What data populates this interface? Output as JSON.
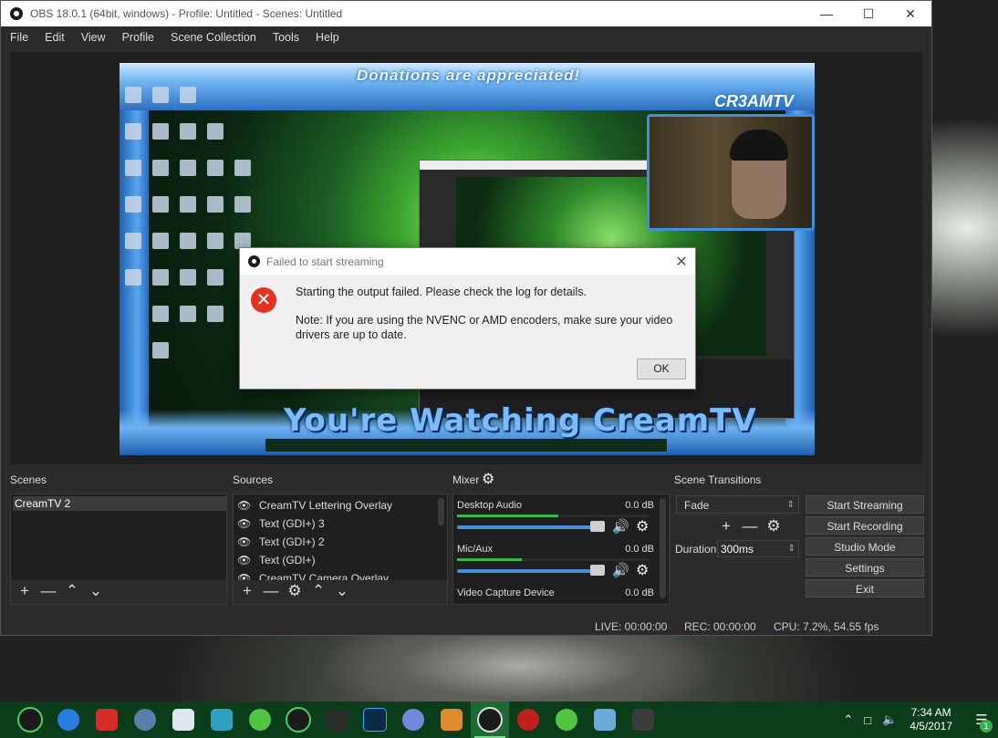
{
  "window": {
    "title": "OBS 18.0.1 (64bit, windows) - Profile: Untitled - Scenes: Untitled"
  },
  "menu": [
    "File",
    "Edit",
    "View",
    "Profile",
    "Scene Collection",
    "Tools",
    "Help"
  ],
  "preview": {
    "donations_text": "Donations are appreciated!",
    "watching_text": "You're Watching CreamTV",
    "logo_text": "CR3AMTV"
  },
  "dialog": {
    "title": "Failed to start streaming",
    "message": "Starting the output failed.  Please check the log for details.",
    "note": "Note: If you are using the NVENC or AMD encoders, make sure your video drivers are up to date.",
    "ok_label": "OK"
  },
  "docks": {
    "scenes_title": "Scenes",
    "sources_title": "Sources",
    "mixer_title": "Mixer",
    "transitions_title": "Scene Transitions"
  },
  "scenes": [
    "CreamTV 2"
  ],
  "sources": [
    "CreamTV Lettering Overlay",
    "Text (GDI+) 3",
    "Text (GDI+) 2",
    "Text (GDI+)",
    "CreamTV Camera Overlay"
  ],
  "mixer": [
    {
      "name": "Desktop Audio",
      "db": "0.0 dB",
      "level": 0.53
    },
    {
      "name": "Mic/Aux",
      "db": "0.0 dB",
      "level": 0.34
    },
    {
      "name": "Video Capture Device",
      "db": "0.0 dB",
      "level": 0
    }
  ],
  "transitions": {
    "selected": "Fade",
    "duration_label": "Duration",
    "duration_value": "300ms"
  },
  "controls": {
    "start_streaming": "Start Streaming",
    "start_recording": "Start Recording",
    "studio_mode": "Studio Mode",
    "settings": "Settings",
    "exit": "Exit"
  },
  "status": {
    "live": "LIVE: 00:00:00",
    "rec": "REC: 00:00:00",
    "cpu": "CPU: 7.2%, 54.55 fps"
  },
  "taskbar": {
    "time": "7:34 AM",
    "date": "4/5/2017",
    "notification_count": "1"
  },
  "colors": {
    "accent_blue": "#4a8fdc",
    "error_red": "#e5321f",
    "meter_green": "#3cb54a",
    "taskbar_green": "#0c3d1a"
  }
}
